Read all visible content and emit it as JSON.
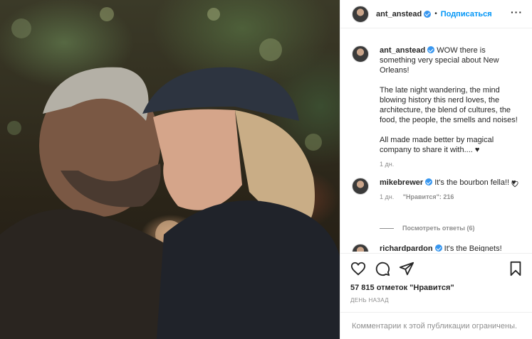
{
  "header": {
    "username": "ant_anstead",
    "separator": "•",
    "follow_label": "Подписаться",
    "more_label": "···"
  },
  "caption": {
    "username": "ant_anstead",
    "text": "WOW there is something very special about New Orleans!\n\nThe late night wandering, the mind blowing history this nerd loves, the architecture, the blend of cultures, the food, the people, the smells and noises!\n\nAll made made better by magical company to share it with.... ♥",
    "time": "1 дн."
  },
  "comments": [
    {
      "username": "mikebrewer",
      "text": "It's the bourbon fella!! ♥",
      "time": "1 дн.",
      "likes": "\"Нравится\": 216"
    },
    {
      "username": "richardpardon",
      "text": "It's the Beignets!",
      "time": "",
      "likes": ""
    }
  ],
  "view_replies_label": "Посмотреть ответы (6)",
  "stats": {
    "likes_text": "57 815 отметок \"Нравится\"",
    "posted_time": "ДЕНЬ НАЗАД"
  },
  "footer": {
    "comments_restricted": "Комментарии к этой публикации ограничены."
  },
  "colors": {
    "accent": "#0095f6",
    "verified": "#3897f0",
    "muted": "#8e8e8e",
    "text": "#262626"
  }
}
